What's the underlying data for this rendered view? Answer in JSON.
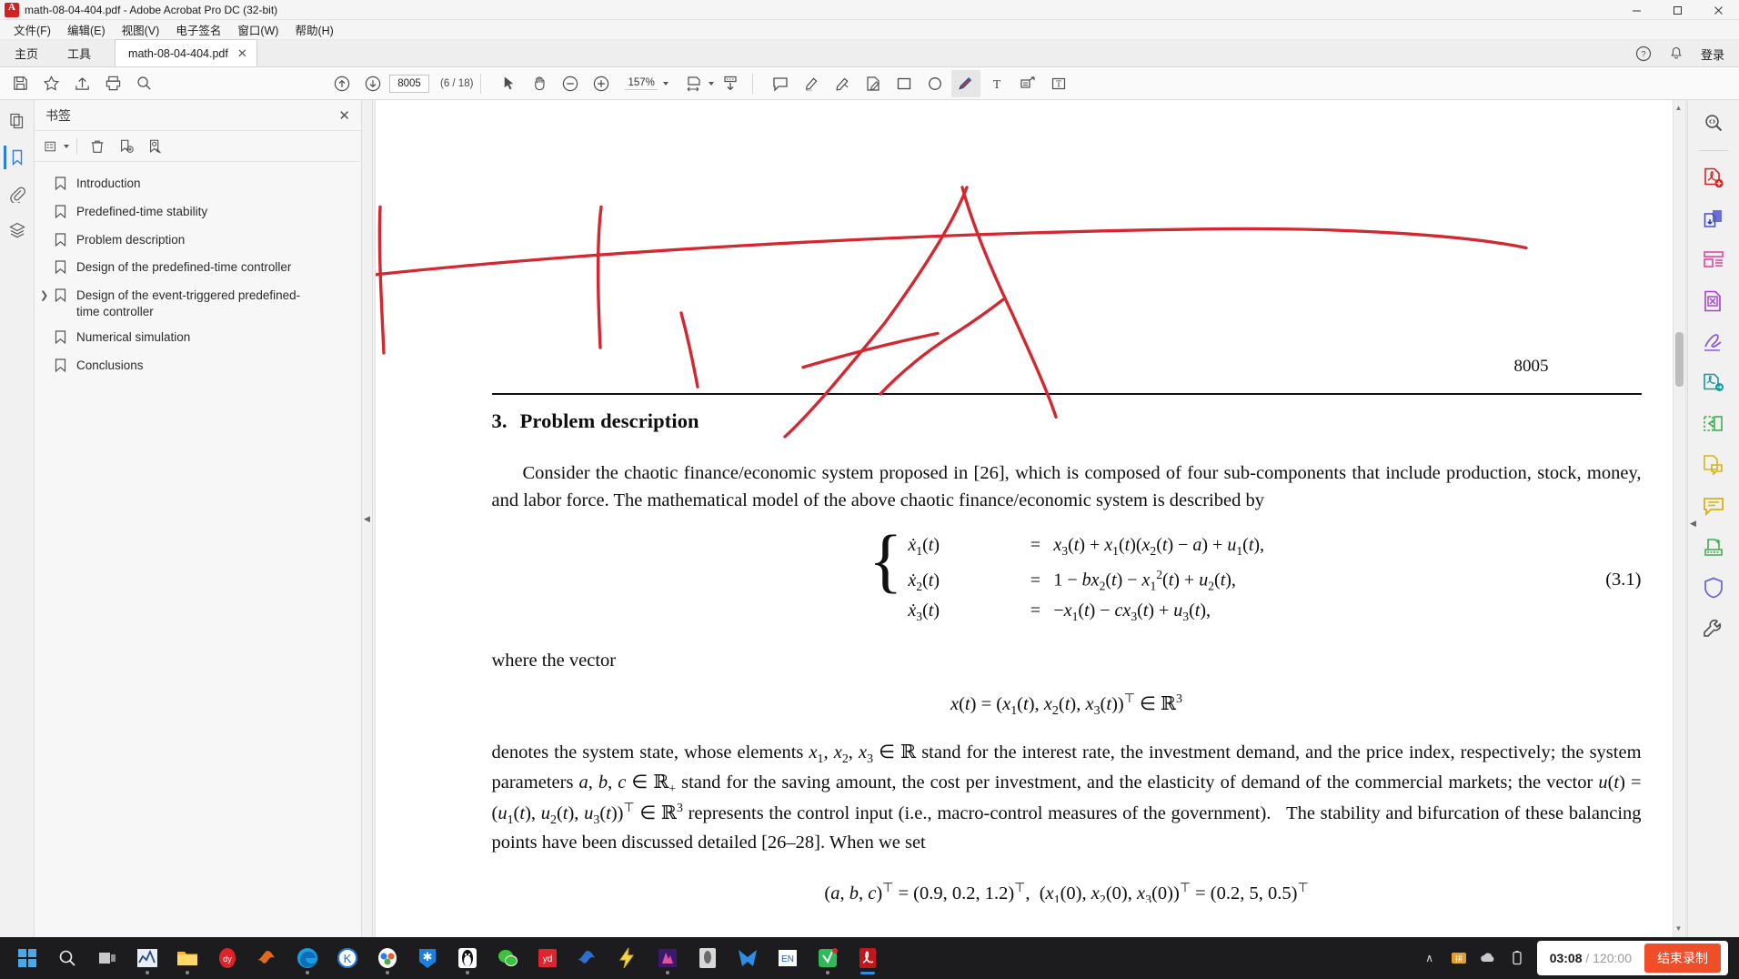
{
  "window": {
    "title": "math-08-04-404.pdf - Adobe Acrobat Pro DC (32-bit)",
    "minimize": "─",
    "maximize": "☐",
    "close": "✕"
  },
  "menubar": [
    {
      "label": "文件(F)"
    },
    {
      "label": "编辑(E)"
    },
    {
      "label": "视图(V)"
    },
    {
      "label": "电子签名"
    },
    {
      "label": "窗口(W)"
    },
    {
      "label": "帮助(H)"
    }
  ],
  "tabstrip": {
    "home": "主页",
    "tools": "工具",
    "doc_tab": "math-08-04-404.pdf",
    "doc_tab_close": "✕",
    "login": "登录"
  },
  "toolbar": {
    "page_value": "8005",
    "page_count": "(6 / 18)",
    "zoom_value": "157%"
  },
  "bookmarks": {
    "panel_title": "书签",
    "close": "✕",
    "items": [
      {
        "label": "Introduction",
        "expandable": false
      },
      {
        "label": "Predefined-time stability",
        "expandable": false
      },
      {
        "label": "Problem description",
        "expandable": false
      },
      {
        "label": "Design of the predefined-time controller",
        "expandable": false
      },
      {
        "label": "Design of the event-triggered predefined-time controller",
        "expandable": true
      },
      {
        "label": "Numerical simulation",
        "expandable": false
      },
      {
        "label": "Conclusions",
        "expandable": false
      }
    ]
  },
  "document": {
    "page_number": "8005",
    "section_number": "3.",
    "section_title": "Problem description",
    "paragraph_1": "Consider the chaotic finance/economic system proposed in [26], which is composed of four sub-components that include production, stock, money, and labor force.  The mathematical model of the above chaotic finance/economic system is described by",
    "equation": {
      "tag": "(3.1)",
      "lines": [
        {
          "lhs": "ẋ₁(t)",
          "eq": "=",
          "rhs": "x₃(t) + x₁(t)(x₂(t) − a) + u₁(t),"
        },
        {
          "lhs": "ẋ₂(t)",
          "eq": "=",
          "rhs": "1 − bx₂(t) − x₁²(t) + u₂(t),"
        },
        {
          "lhs": "ẋ₃(t)",
          "eq": "=",
          "rhs": "−x₁(t) − cx₃(t) + u₃(t),"
        }
      ]
    },
    "paragraph_2": "where the vector",
    "centered_equation": "x(t) = (x₁(t), x₂(t), x₃(t))ᵀ ∈ ℝ³",
    "paragraph_3": "denotes the system state, whose elements x₁, x₂, x₃ ∈ ℝ stand for the interest rate, the investment demand, and the price index, respectively; the system parameters a, b, c ∈ ℝ₊ stand for the saving amount, the cost per investment, and the elasticity of demand of the commercial markets; the vector u(t) = (u₁(t), u₂(t), u₃(t))ᵀ ∈ ℝ³ represents the control input (i.e., macro-control measures of the government).  The stability and bifurcation of these balancing points have been discussed detailed [26–28]. When we set",
    "paragraph_4_clipped": "(a, b, c)ᵀ = (0.9, 0.2, 1.2)ᵀ, (x₁(0), x₂(0), x₃(0))ᵀ = (0.2, 5, 0.5)ᵀ",
    "ink_color": "#d42730"
  },
  "taskbar": {
    "recording_elapsed": "03:08",
    "recording_total": "120:00",
    "recording_separator": "/",
    "stop_button": "结束录制",
    "ime_label": "EN",
    "chevron": "∧"
  }
}
